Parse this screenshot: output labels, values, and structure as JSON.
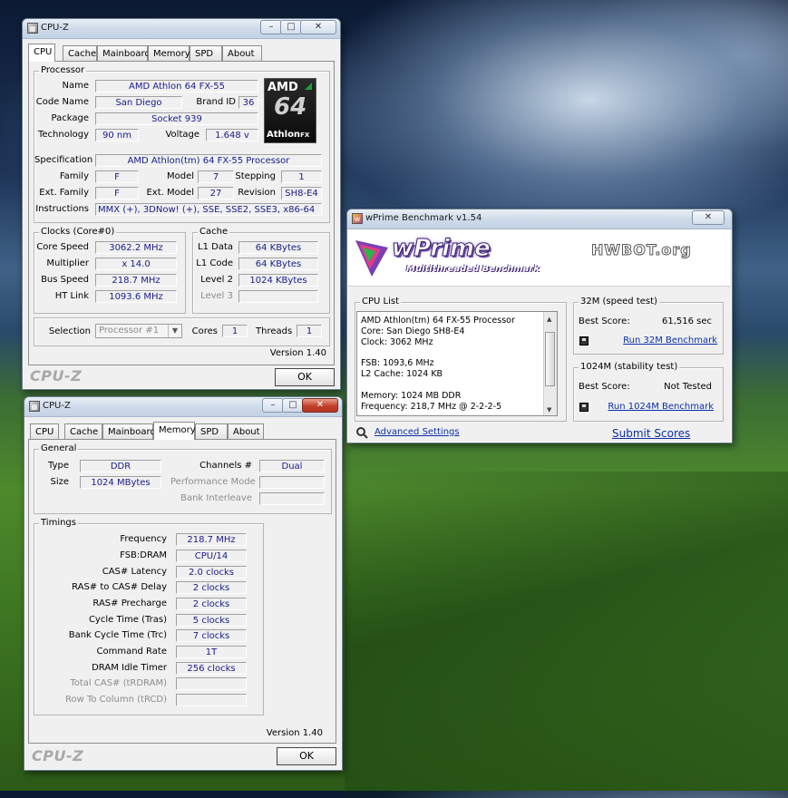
{
  "cpuz1": {
    "title": "CPU-Z",
    "tabs": [
      "CPU",
      "Cache",
      "Mainboard",
      "Memory",
      "SPD",
      "About"
    ],
    "active_tab": "CPU",
    "processor": {
      "group": "Processor",
      "name_label": "Name",
      "name": "AMD Athlon 64 FX-55",
      "codename_label": "Code Name",
      "codename": "San Diego",
      "brandid_label": "Brand ID",
      "brandid": "36",
      "package_label": "Package",
      "package": "Socket 939",
      "technology_label": "Technology",
      "technology": "90 nm",
      "voltage_label": "Voltage",
      "voltage": "1.648 v",
      "spec_label": "Specification",
      "spec": "AMD Athlon(tm) 64 FX-55 Processor",
      "family_label": "Family",
      "family": "F",
      "model_label": "Model",
      "model": "7",
      "stepping_label": "Stepping",
      "stepping": "1",
      "extfamily_label": "Ext. Family",
      "extfamily": "F",
      "extmodel_label": "Ext. Model",
      "extmodel": "27",
      "revision_label": "Revision",
      "revision": "SH8-E4",
      "instr_label": "Instructions",
      "instr": "MMX (+), 3DNow! (+), SSE, SSE2, SSE3, x86-64"
    },
    "logo": {
      "brand": "AMD",
      "num": "64",
      "line": "Athlon",
      "suffix": "FX"
    },
    "clocks": {
      "group": "Clocks (Core#0)",
      "core_label": "Core Speed",
      "core": "3062.2 MHz",
      "mult_label": "Multiplier",
      "mult": "x 14.0",
      "bus_label": "Bus Speed",
      "bus": "218.7 MHz",
      "ht_label": "HT Link",
      "ht": "1093.6 MHz"
    },
    "cache": {
      "group": "Cache",
      "l1d_label": "L1 Data",
      "l1d": "64 KBytes",
      "l1c_label": "L1 Code",
      "l1c": "64 KBytes",
      "l2_label": "Level 2",
      "l2": "1024 KBytes",
      "l3_label": "Level 3",
      "l3": ""
    },
    "selection_label": "Selection",
    "selection": "Processor #1",
    "cores_label": "Cores",
    "cores": "1",
    "threads_label": "Threads",
    "threads": "1",
    "version": "Version 1.40",
    "brand": "CPU-Z",
    "ok": "OK"
  },
  "cpuz2": {
    "title": "CPU-Z",
    "tabs": [
      "CPU",
      "Cache",
      "Mainboard",
      "Memory",
      "SPD",
      "About"
    ],
    "active_tab": "Memory",
    "general": {
      "group": "General",
      "type_label": "Type",
      "type": "DDR",
      "channels_label": "Channels #",
      "channels": "Dual",
      "size_label": "Size",
      "size": "1024 MBytes",
      "perf_label": "Performance Mode",
      "perf": "",
      "bank_label": "Bank Interleave",
      "bank": ""
    },
    "timings": {
      "group": "Timings",
      "rows": [
        {
          "label": "Frequency",
          "value": "218.7 MHz"
        },
        {
          "label": "FSB:DRAM",
          "value": "CPU/14"
        },
        {
          "label": "CAS# Latency",
          "value": "2.0 clocks"
        },
        {
          "label": "RAS# to CAS# Delay",
          "value": "2 clocks"
        },
        {
          "label": "RAS# Precharge",
          "value": "2 clocks"
        },
        {
          "label": "Cycle Time (Tras)",
          "value": "5 clocks"
        },
        {
          "label": "Bank Cycle Time (Trc)",
          "value": "7 clocks"
        },
        {
          "label": "Command Rate",
          "value": "1T"
        },
        {
          "label": "DRAM Idle Timer",
          "value": "256 clocks"
        },
        {
          "label": "Total CAS# (tRDRAM)",
          "value": ""
        },
        {
          "label": "Row To Column (tRCD)",
          "value": ""
        }
      ]
    },
    "version": "Version 1.40",
    "brand": "CPU-Z",
    "ok": "OK"
  },
  "wprime": {
    "title": "wPrime Benchmark v1.54",
    "logo": "wPrime",
    "subtitle": "Multithreaded Benchmark",
    "hwbot": "HWBOT.org",
    "cpu_list_label": "CPU List",
    "cpu_lines": [
      "AMD Athlon(tm) 64 FX-55 Processor",
      "Core: San Diego SH8-E4",
      "Clock: 3062 MHz",
      "",
      "FSB: 1093,6 MHz",
      "L2 Cache: 1024 KB",
      "",
      "Memory: 1024 MB DDR",
      "Frequency: 218,7 MHz @ 2-2-2-5"
    ],
    "test32": {
      "group": "32M (speed test)",
      "score_label": "Best Score:",
      "score": "61,516 sec",
      "run": "Run 32M Benchmark"
    },
    "test1024": {
      "group": "1024M (stability test)",
      "score_label": "Best Score:",
      "score": "Not Tested",
      "run": "Run 1024M Benchmark"
    },
    "advanced": "Advanced Settings",
    "submit": "Submit Scores"
  }
}
